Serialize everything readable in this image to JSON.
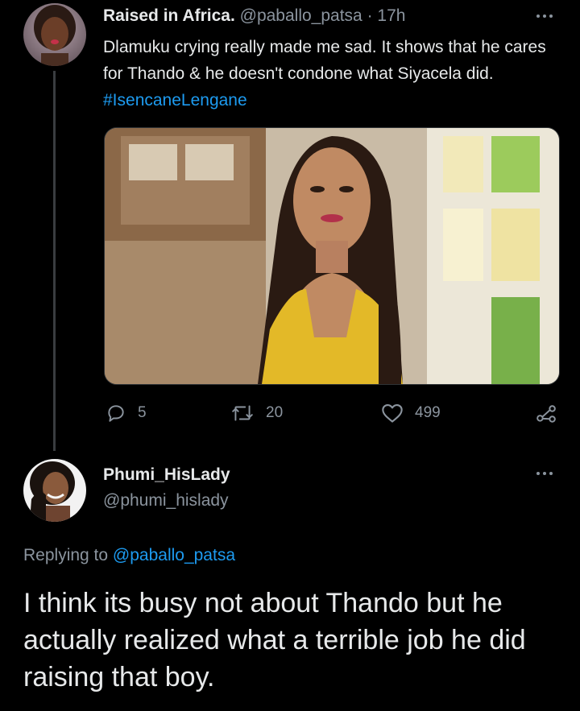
{
  "tweet": {
    "display_name": "Raised in Africa.",
    "handle": "@paballo_patsa",
    "separator": "·",
    "time": "17h",
    "text_plain": "Dlamuku crying really made me sad. It shows that he cares for Thando & he doesn't condone what Siyacela did.",
    "hashtag": "#IsencaneLengane",
    "actions": {
      "replies": "5",
      "retweets": "20",
      "likes": "499"
    },
    "icons": {
      "reply": "reply-icon",
      "retweet": "retweet-icon",
      "like": "heart-icon",
      "share": "share-icon",
      "more": "more-icon"
    }
  },
  "reply": {
    "display_name": "Phumi_HisLady",
    "handle": "@phumi_hislady",
    "replying_to_label": "Replying to",
    "replying_to_handle": "@paballo_patsa",
    "text": "I think its busy not about Thando but he actually realized what a terrible job he did raising that boy."
  },
  "colors": {
    "background": "#000000",
    "text": "#e7e9ea",
    "muted": "#8b949e",
    "link": "#1d9bf0"
  }
}
